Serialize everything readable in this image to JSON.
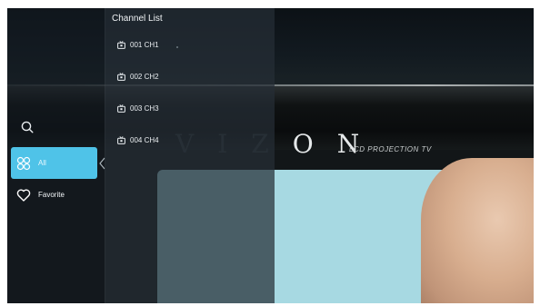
{
  "background": {
    "brand_text": "VIZON",
    "brand_subtitle": "LCD PROJECTION TV"
  },
  "sidebar": {
    "items": [
      {
        "id": "all",
        "label": "All",
        "icon": "grid-icon",
        "selected": true
      },
      {
        "id": "favorite",
        "label": "Favorite",
        "icon": "heart-icon",
        "selected": false
      }
    ],
    "search_icon": "search-icon",
    "accent_color": "#4fc3e8"
  },
  "channel_list": {
    "title": "Channel List",
    "channels": [
      {
        "number": "001",
        "name": "CH1",
        "label": "001 CH1"
      },
      {
        "number": "002",
        "name": "CH2",
        "label": "002 CH2"
      },
      {
        "number": "003",
        "name": "CH3",
        "label": "003 CH3"
      },
      {
        "number": "004",
        "name": "CH4",
        "label": "004 CH4"
      }
    ]
  }
}
